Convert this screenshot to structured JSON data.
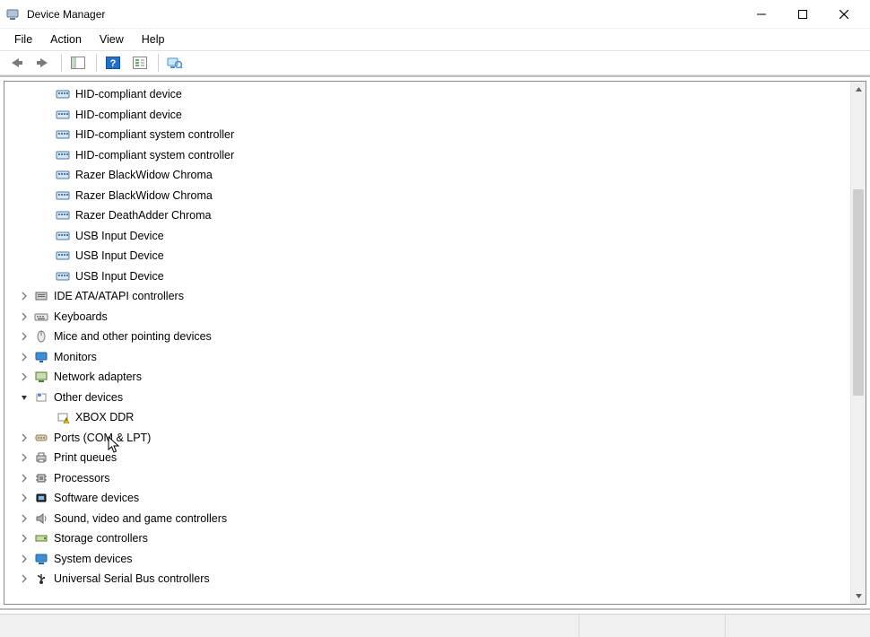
{
  "window": {
    "title": "Device Manager"
  },
  "menu": [
    "File",
    "Action",
    "View",
    "Help"
  ],
  "hid_children": [
    "HID-compliant device",
    "HID-compliant device",
    "HID-compliant system controller",
    "HID-compliant system controller",
    "Razer BlackWidow Chroma",
    "Razer BlackWidow Chroma",
    "Razer DeathAdder Chroma",
    "USB Input Device",
    "USB Input Device",
    "USB Input Device"
  ],
  "other_children": [
    "XBOX DDR"
  ],
  "categories": [
    {
      "label": "IDE ATA/ATAPI controllers",
      "icon": "ide",
      "expanded": false
    },
    {
      "label": "Keyboards",
      "icon": "keyboard",
      "expanded": false
    },
    {
      "label": "Mice and other pointing devices",
      "icon": "mouse",
      "expanded": false
    },
    {
      "label": "Monitors",
      "icon": "monitor",
      "expanded": false
    },
    {
      "label": "Network adapters",
      "icon": "network",
      "expanded": false
    },
    {
      "label": "Other devices",
      "icon": "other",
      "expanded": true
    },
    {
      "label": "Ports (COM & LPT)",
      "icon": "port",
      "expanded": false
    },
    {
      "label": "Print queues",
      "icon": "printer",
      "expanded": false
    },
    {
      "label": "Processors",
      "icon": "cpu",
      "expanded": false
    },
    {
      "label": "Software devices",
      "icon": "software",
      "expanded": false
    },
    {
      "label": "Sound, video and game controllers",
      "icon": "sound",
      "expanded": false
    },
    {
      "label": "Storage controllers",
      "icon": "storage",
      "expanded": false
    },
    {
      "label": "System devices",
      "icon": "system",
      "expanded": false
    },
    {
      "label": "Universal Serial Bus controllers",
      "icon": "usb",
      "expanded": false
    }
  ]
}
